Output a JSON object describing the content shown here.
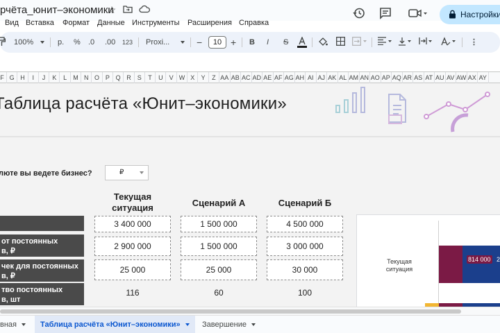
{
  "app": {
    "doc_title": "рчёта_юнит–экономики"
  },
  "header": {
    "settings_label": "Настройки"
  },
  "menu": [
    "Вид",
    "Вставка",
    "Формат",
    "Данные",
    "Инструменты",
    "Расширения",
    "Справка"
  ],
  "toolbar": {
    "zoom": "100%",
    "currency_symbol": "р.",
    "percent": "%",
    "decrease_decimals": ".0",
    "increase_decimals": ".00",
    "more_formats": "123",
    "font_name": "Proxi...",
    "font_size": "10",
    "bold": "B",
    "italic": "I",
    "strike": "S"
  },
  "column_headers": [
    "F",
    "G",
    "H",
    "I",
    "J",
    "K",
    "L",
    "M",
    "N",
    "O",
    "P",
    "Q",
    "R",
    "S",
    "T",
    "U",
    "V",
    "W",
    "X",
    "Y",
    "Z",
    "AA",
    "AB",
    "AC",
    "AD",
    "AE",
    "AF",
    "AG",
    "AH",
    "AI",
    "AJ",
    "AK",
    "AL",
    "AM",
    "AN",
    "AO",
    "AP",
    "AQ",
    "AR",
    "AS",
    "AT",
    "AU",
    "AV",
    "AW",
    "AX",
    "AY"
  ],
  "sheet": {
    "title": "Таблица расчёта «Юнит–экономики»",
    "question": "люте вы ведете бизнес?",
    "currency_value": "₽",
    "columns": {
      "current": "Текущая ситуация",
      "scenario_a": "Сценарий А",
      "scenario_b": "Сценарий Б"
    },
    "rows": [
      {
        "label": "",
        "current": "3 400 000",
        "a": "1 500 000",
        "b": "4 500 000"
      },
      {
        "label_line1": "от постоянных",
        "label_line2": "в, ₽",
        "current": "2 900 000",
        "a": "1 500 000",
        "b": "3 000 000"
      },
      {
        "label_line1": "чек для постоянных",
        "label_line2": "в, ₽",
        "current": "25 000",
        "a": "25 000",
        "b": "30 000"
      },
      {
        "label_line1": "тво постоянных",
        "label_line2": "в, шт",
        "current": "116",
        "a": "60",
        "b": "100"
      }
    ],
    "chart": {
      "category": "Текущая ситуация",
      "bar_label": "814 000",
      "bar_label_2": "2",
      "colors": {
        "series1": "#7b1a45",
        "series2": "#1b3f8c"
      }
    }
  },
  "tabs": [
    {
      "label": "вная"
    },
    {
      "label": "Таблица расчёта «Юнит–экономики»",
      "active": true
    },
    {
      "label": "Завершение"
    }
  ]
}
